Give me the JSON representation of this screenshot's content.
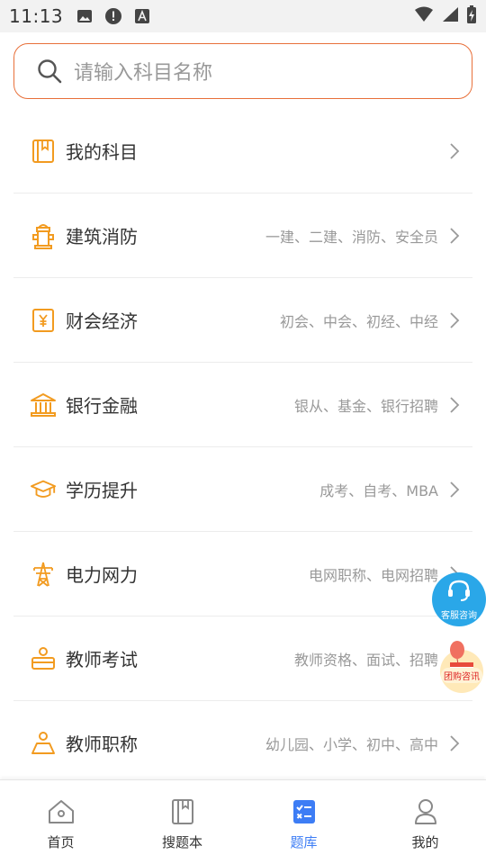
{
  "status_bar": {
    "time": "11:13"
  },
  "search": {
    "placeholder": "请输入科目名称"
  },
  "categories": [
    {
      "title": "我的科目",
      "subtitle": ""
    },
    {
      "title": "建筑消防",
      "subtitle": "一建、二建、消防、安全员"
    },
    {
      "title": "财会经济",
      "subtitle": "初会、中会、初经、中经"
    },
    {
      "title": "银行金融",
      "subtitle": "银从、基金、银行招聘"
    },
    {
      "title": "学历提升",
      "subtitle": "成考、自考、MBA"
    },
    {
      "title": "电力网力",
      "subtitle": "电网职称、电网招聘"
    },
    {
      "title": "教师考试",
      "subtitle": "教师资格、面试、招聘"
    },
    {
      "title": "教师职称",
      "subtitle": "幼儿园、小学、初中、高中"
    }
  ],
  "floating": {
    "service_label": "客服咨询",
    "group_label": "团购咨讯"
  },
  "bottom_nav": [
    {
      "label": "首页",
      "active": false
    },
    {
      "label": "搜题本",
      "active": false
    },
    {
      "label": "题库",
      "active": true
    },
    {
      "label": "我的",
      "active": false
    }
  ],
  "colors": {
    "accent": "#f29b20",
    "search_border": "#e8703a",
    "nav_active": "#3d7df5",
    "service_bg": "#2aa7e8"
  }
}
